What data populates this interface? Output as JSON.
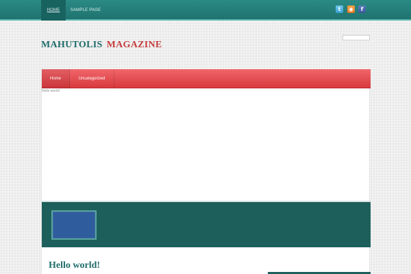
{
  "topnav": {
    "home": "HOME",
    "sample_page": "SAMPLE PAGE"
  },
  "social": {
    "twitter": "t",
    "rss": "◉",
    "facebook": "f"
  },
  "logo": {
    "part1": "MAHUTOLIS",
    "part2": "MAGAZINE"
  },
  "menu": {
    "home": "Home",
    "uncategorized": "Uncategorized"
  },
  "breadcrumb": "Hello world!",
  "post": {
    "title": "Hello world!"
  },
  "colors": {
    "teal": "#1f736f",
    "red": "#d83a3f",
    "featured_bg": "#1c5f5b",
    "thumb": "#2e5c9c"
  }
}
